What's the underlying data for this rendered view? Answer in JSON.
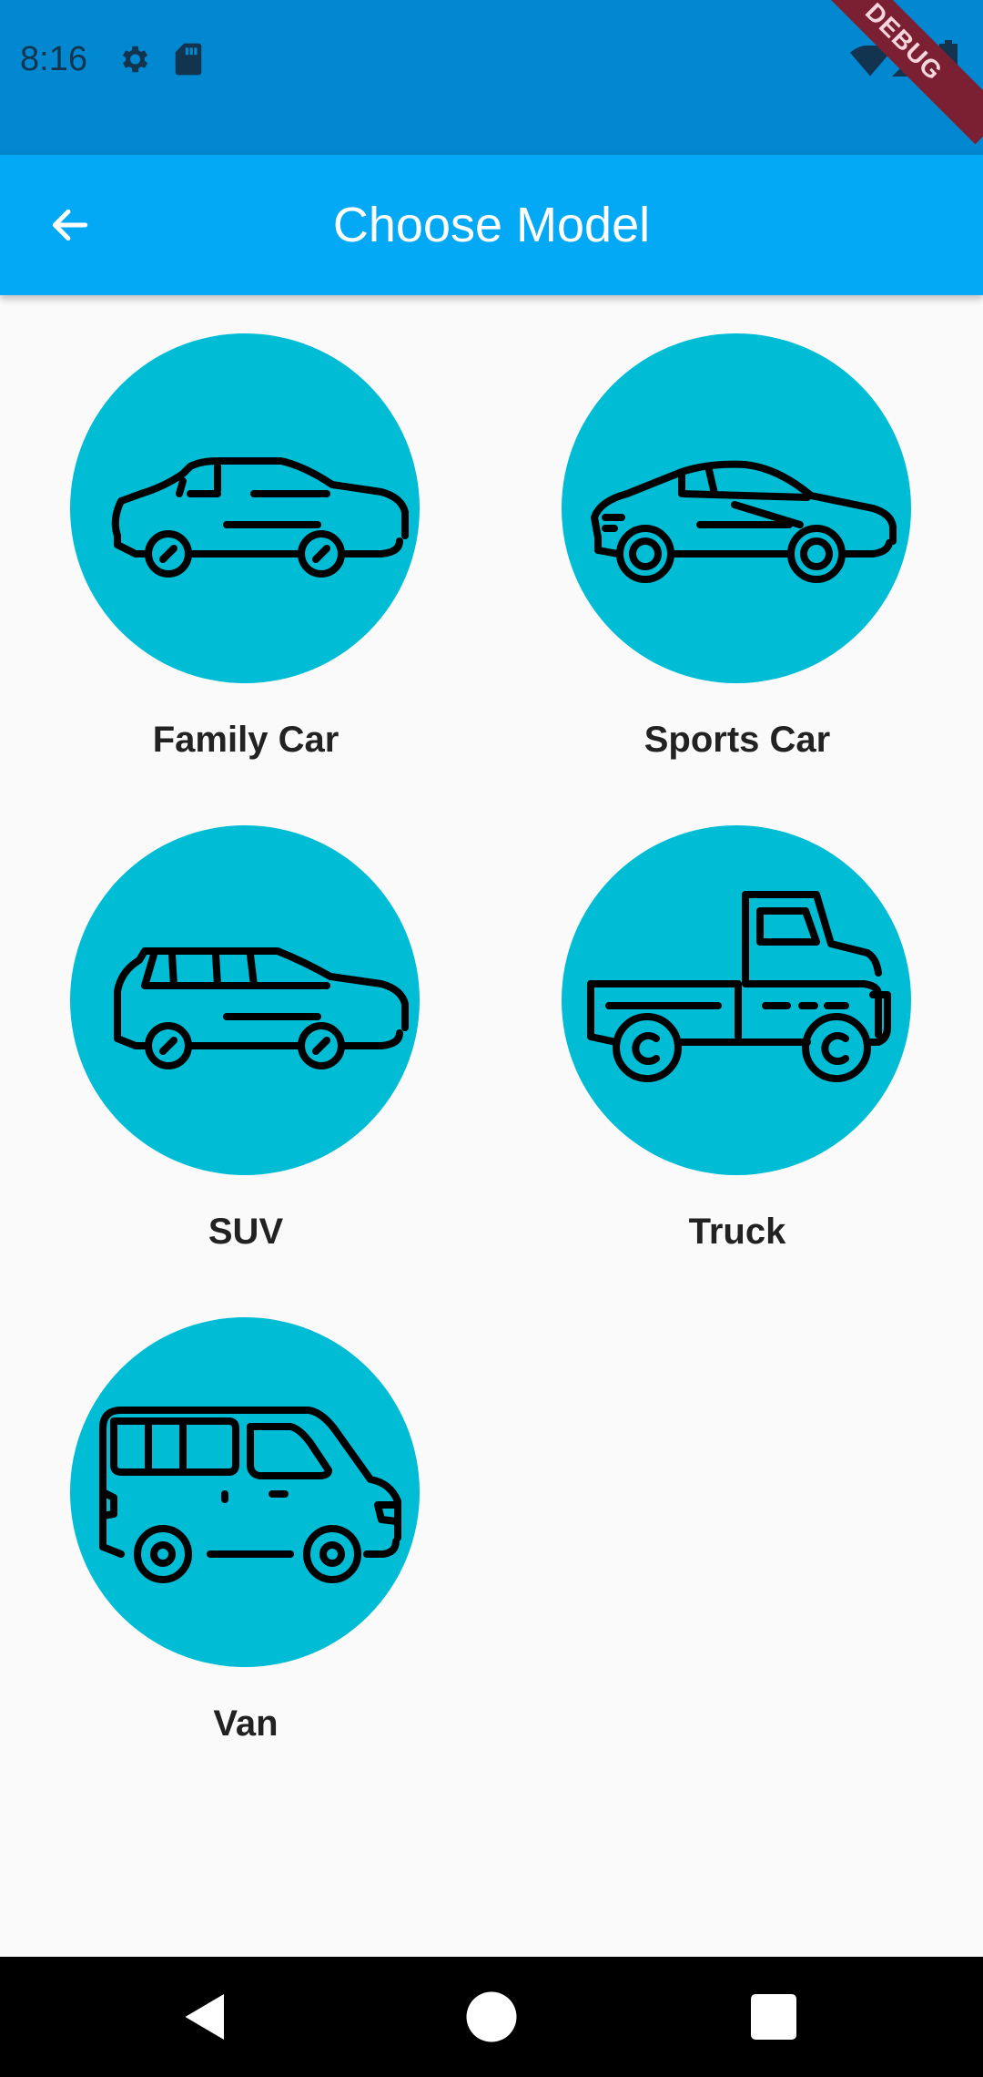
{
  "status_bar": {
    "time": "8:16",
    "left_icons": [
      "gear-icon",
      "sd-card-icon"
    ],
    "right_icons": [
      "wifi-icon",
      "signal-icon",
      "battery-icon"
    ],
    "color": "#0288d1"
  },
  "debug_banner": {
    "text": "DEBUG"
  },
  "app_bar": {
    "title": "Choose Model",
    "back_icon": "arrow-left-icon",
    "color": "#03a9f4"
  },
  "models": [
    {
      "label": "Family Car",
      "icon": "sedan-icon"
    },
    {
      "label": "Sports Car",
      "icon": "sports-car-icon"
    },
    {
      "label": "SUV",
      "icon": "suv-icon"
    },
    {
      "label": "Truck",
      "icon": "pickup-truck-icon"
    },
    {
      "label": "Van",
      "icon": "van-icon"
    }
  ],
  "accent_color": "#00bcd4",
  "nav_bar": {
    "buttons": [
      "back-triangle-icon",
      "home-circle-icon",
      "recents-square-icon"
    ]
  }
}
